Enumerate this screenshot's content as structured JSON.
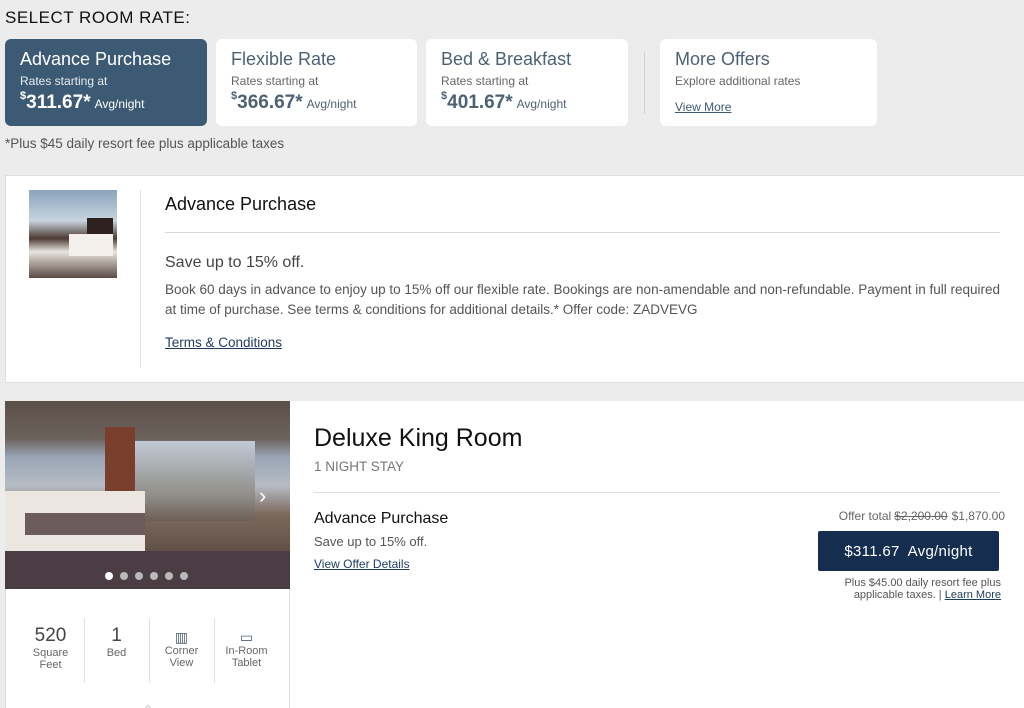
{
  "page": {
    "section_title": "SELECT ROOM RATE:",
    "fee_note": "*Plus $45 daily resort fee plus applicable taxes"
  },
  "rate_cards": [
    {
      "title": "Advance Purchase",
      "subtitle": "Rates starting at",
      "currency": "$",
      "price": "311.67*",
      "unit": "Avg/night",
      "selected": true
    },
    {
      "title": "Flexible Rate",
      "subtitle": "Rates starting at",
      "currency": "$",
      "price": "366.67*",
      "unit": "Avg/night",
      "selected": false
    },
    {
      "title": "Bed & Breakfast",
      "subtitle": "Rates starting at",
      "currency": "$",
      "price": "401.67*",
      "unit": "Avg/night",
      "selected": false
    }
  ],
  "more_offers": {
    "title": "More Offers",
    "subtitle": "Explore additional rates",
    "link": "View More"
  },
  "offer_panel": {
    "title": "Advance Purchase",
    "save": "Save up to 15% off.",
    "description": "Book 60 days in advance to enjoy up to 15% off our flexible rate. Bookings are non-amendable and non-refundable. Payment in full required at time of purchase. See terms & conditions for additional details.* Offer code: ZADVEVG",
    "terms_link": "Terms & Conditions"
  },
  "room": {
    "title": "Deluxe King Room",
    "stay": "1 NIGHT STAY",
    "carousel": {
      "total": 6,
      "current": 1
    },
    "amenities": [
      {
        "value": "520",
        "label": "Square Feet"
      },
      {
        "value": "1",
        "label": "Bed"
      },
      {
        "icon": "building-icon",
        "label": "Corner View"
      },
      {
        "icon": "tablet-icon",
        "label": "In-Room Tablet"
      }
    ],
    "rate": {
      "name": "Advance Purchase",
      "save": "Save up to 15% off.",
      "details_link": "View Offer Details",
      "offer_total_label": "Offer total",
      "original_total": "$2,200.00",
      "final_total": "$1,870.00",
      "button_price": "$311.67",
      "button_unit": "Avg/night",
      "resort_note": "Plus $45.00 daily resort fee plus applicable taxes. |",
      "learn_more": "Learn More"
    }
  },
  "colors": {
    "selected_card": "#3d5a74",
    "book_button": "#152d4f",
    "link": "#1e3a5f",
    "background": "#ececec"
  }
}
